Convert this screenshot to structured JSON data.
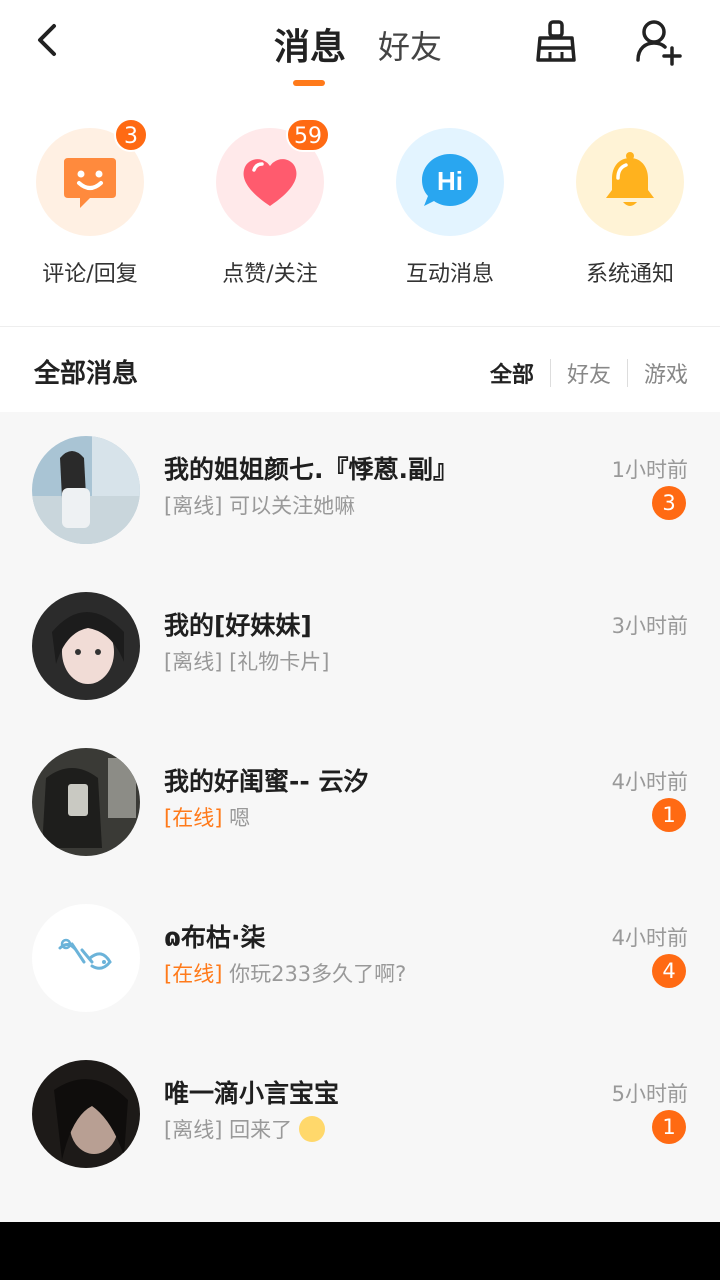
{
  "header": {
    "tabs": [
      {
        "label": "消息",
        "active": true
      },
      {
        "label": "好友",
        "active": false
      }
    ],
    "accent_color": "#ff7a1a"
  },
  "categories": [
    {
      "label": "评论/回复",
      "badge": "3",
      "icon": "smile-chat-icon",
      "bg": "#fff0e3",
      "icon_color": "#ff8a3d"
    },
    {
      "label": "点赞/关注",
      "badge": "59",
      "icon": "heart-icon",
      "bg": "#ffe9ea",
      "icon_color": "#ff5b6e"
    },
    {
      "label": "互动消息",
      "badge": "",
      "icon": "hi-bubble-icon",
      "bg": "#e3f4ff",
      "icon_color": "#29a6f0"
    },
    {
      "label": "系统通知",
      "badge": "",
      "icon": "bell-icon",
      "bg": "#fff3d6",
      "icon_color": "#ffb21e"
    }
  ],
  "section": {
    "title": "全部消息",
    "filters": [
      "全部",
      "好友",
      "游戏"
    ],
    "selected_filter": "全部"
  },
  "messages": [
    {
      "name": "我的姐姐颜七.『悸蒽.副』",
      "status": "[离线]",
      "online": false,
      "text": "可以关注她嘛",
      "time": "1小时前",
      "unread": "3"
    },
    {
      "name": "我的[好妹妹]",
      "status": "[离线]",
      "online": false,
      "text": "[礼物卡片]",
      "time": "3小时前",
      "unread": ""
    },
    {
      "name": "我的好闺蜜-- 云汐",
      "status": "[在线]",
      "online": true,
      "text": "嗯",
      "time": "4小时前",
      "unread": "1"
    },
    {
      "name": "ɷ布枯·柒",
      "status": "[在线]",
      "online": true,
      "text": "你玩233多久了啊?",
      "time": "4小时前",
      "unread": "4"
    },
    {
      "name": "唯一滴小言宝宝",
      "status": "[离线]",
      "online": false,
      "text": "回来了",
      "time": "5小时前",
      "unread": "1"
    }
  ]
}
